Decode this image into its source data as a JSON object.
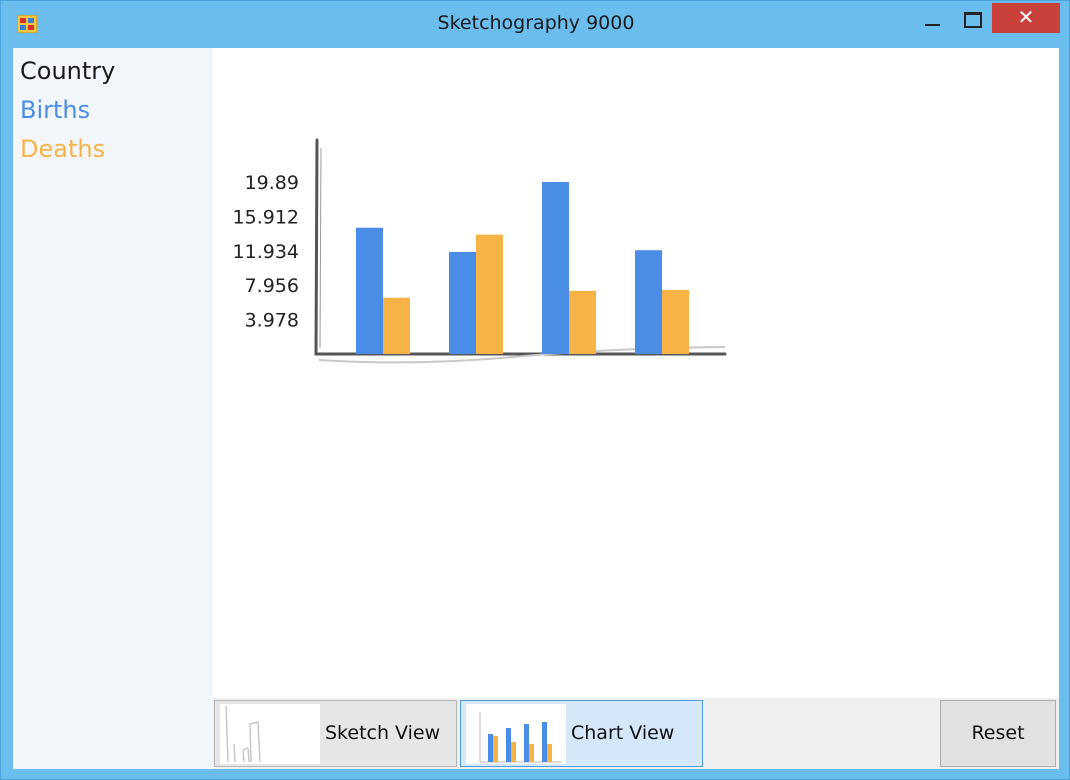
{
  "window": {
    "title": "Sketchography 9000",
    "close_glyph": "✕"
  },
  "legend": {
    "items": [
      {
        "label": "Country",
        "color": "#1b1b1b"
      },
      {
        "label": "Births",
        "color": "#4a8de6"
      },
      {
        "label": "Deaths",
        "color": "#f7b345"
      }
    ]
  },
  "chart_data": {
    "type": "bar",
    "categories": [
      "",
      "",
      "",
      ""
    ],
    "series": [
      {
        "name": "Births",
        "color": "#4a8de6",
        "values": [
          14.6,
          11.8,
          19.89,
          12.0
        ]
      },
      {
        "name": "Deaths",
        "color": "#f7b345",
        "values": [
          6.5,
          13.8,
          7.3,
          7.4
        ]
      }
    ],
    "y_ticks": [
      "3.978",
      "7.956",
      "11.934",
      "15.912",
      "19.89"
    ],
    "ylim": [
      0,
      19.89
    ],
    "grid": false
  },
  "toolbar": {
    "sketch_view_label": "Sketch View",
    "chart_view_label": "Chart View",
    "reset_label": "Reset",
    "active_view": "Chart View"
  }
}
